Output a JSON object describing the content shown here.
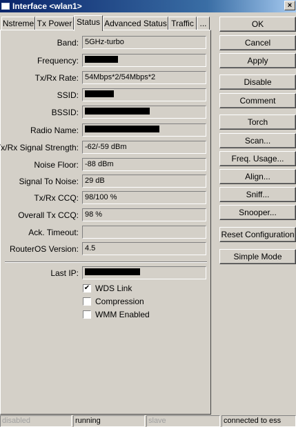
{
  "window": {
    "title": "Interface <wlan1>",
    "close_glyph": "×"
  },
  "tabs": [
    "Nstreme",
    "Tx Power",
    "Status",
    "Advanced Status",
    "Traffic",
    "..."
  ],
  "active_tab": "Status",
  "fields": {
    "band": {
      "label": "Band:",
      "value": "5GHz-turbo"
    },
    "frequency": {
      "label": "Frequency:",
      "value": ""
    },
    "txrx_rate": {
      "label": "Tx/Rx Rate:",
      "value": "54Mbps*2/54Mbps*2"
    },
    "ssid": {
      "label": "SSID:",
      "value": ""
    },
    "bssid": {
      "label": "BSSID:",
      "value": ""
    },
    "radio_name": {
      "label": "Radio Name:",
      "value": ""
    },
    "signal_strength": {
      "label": "Tx/Rx Signal Strength:",
      "value": "-62/-59 dBm"
    },
    "noise_floor": {
      "label": "Noise Floor:",
      "value": "-88 dBm"
    },
    "signal_to_noise": {
      "label": "Signal To Noise:",
      "value": "29 dB"
    },
    "txrx_ccq": {
      "label": "Tx/Rx CCQ:",
      "value": "98/100 %"
    },
    "overall_tx_ccq": {
      "label": "Overall Tx CCQ:",
      "value": "98 %"
    },
    "ack_timeout": {
      "label": "Ack. Timeout:",
      "value": ""
    },
    "routeros_version": {
      "label": "RouterOS Version:",
      "value": "4.5"
    },
    "last_ip": {
      "label": "Last IP:",
      "value": ""
    }
  },
  "checkboxes": [
    {
      "label": "WDS Link",
      "checked": true,
      "mark": "✔"
    },
    {
      "label": "Compression",
      "checked": false,
      "mark": ""
    },
    {
      "label": "WMM Enabled",
      "checked": false,
      "mark": ""
    }
  ],
  "buttons": {
    "ok": "OK",
    "cancel": "Cancel",
    "apply": "Apply",
    "disable": "Disable",
    "comment": "Comment",
    "torch": "Torch",
    "scan": "Scan...",
    "freq_usage": "Freq. Usage...",
    "align": "Align...",
    "sniff": "Sniff...",
    "snooper": "Snooper...",
    "reset_configuration": "Reset Configuration",
    "simple_mode": "Simple Mode"
  },
  "status_bar": [
    "disabled",
    "running",
    "slave",
    "connected to ess"
  ]
}
